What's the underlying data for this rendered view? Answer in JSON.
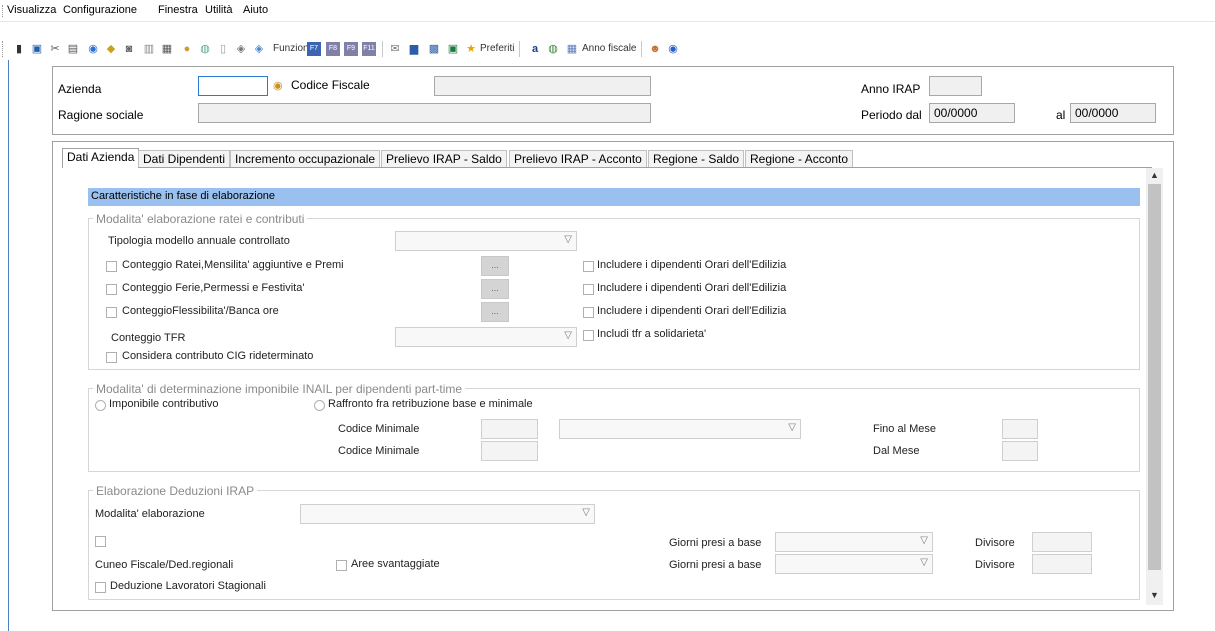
{
  "menu": [
    "Visualizza",
    "Configurazione",
    "Finestra",
    "Utilità",
    "Aiuto"
  ],
  "toolbar": {
    "funzioni_label": "Funzioni:",
    "preferiti_label": "Preferiti",
    "anno_fiscale_label": "Anno fiscale",
    "icons": [
      "pin-icon",
      "save-icon",
      "cut-icon",
      "print-icon",
      "help-icon",
      "info-icon",
      "db-icon",
      "document-icon",
      "calc-icon",
      "color-icon",
      "globe-icon",
      "page-icon",
      "tag-icon",
      "tag2-icon",
      "f7-icon",
      "f8-icon",
      "f9-icon",
      "f11-icon",
      "mail-icon",
      "calendar-icon",
      "chart-icon",
      "excel-icon",
      "star-icon",
      "font-icon",
      "globe2-icon",
      "calendar2-icon",
      "user-icon",
      "help2-icon"
    ]
  },
  "header": {
    "azienda_label": "Azienda",
    "azienda_value": "",
    "codice_fiscale_label": "Codice Fiscale",
    "codice_fiscale_value": "",
    "anno_irap_label": "Anno IRAP",
    "anno_irap_value": "",
    "ragione_sociale_label": "Ragione sociale",
    "ragione_sociale_value": "",
    "periodo_dal_label": "Periodo dal",
    "periodo_dal_value": "00/0000",
    "al_label": "al",
    "al_value": "00/0000"
  },
  "tabs": [
    "Dati Azienda",
    "Dati Dipendenti",
    "Incremento occupazionale",
    "Prelievo IRAP - Saldo",
    "Prelievo IRAP - Acconto",
    "Regione - Saldo",
    "Regione - Acconto"
  ],
  "section_title": "Caratteristiche in fase di elaborazione",
  "group1": {
    "title": "Modalita' elaborazione ratei e contributi",
    "tipologia_label": "Tipologia modello annuale controllato",
    "conteggio_ratei": "Conteggio Ratei,Mensilita' aggiuntive e Premi",
    "conteggio_ferie": "Conteggio Ferie,Permessi e Festivita'",
    "conteggio_flex": "ConteggioFlessibilita'/Banca ore",
    "conteggio_tfr_label": "Conteggio TFR",
    "considera_cig": "Considera contributo CIG rideterminato",
    "includere_1": "Includere i dipendenti Orari dell'Edilizia",
    "includere_2": "Includere i dipendenti Orari dell'Edilizia",
    "includere_3": "Includere i dipendenti Orari dell'Edilizia",
    "includi_tfr": "Includi tfr a solidarieta'",
    "dots": "..."
  },
  "group2": {
    "title": "Modalita' di determinazione imponibile INAIL per dipendenti part-time",
    "imponibile_label": "Imponibile contributivo",
    "raffronto_label": "Raffronto fra retribuzione base e minimale",
    "codice_minimale_1": "Codice Minimale",
    "codice_minimale_2": "Codice Minimale",
    "fino_al_mese": "Fino al Mese",
    "dal_mese": "Dal Mese"
  },
  "group3": {
    "title": "Elaborazione Deduzioni IRAP",
    "modalita_label": "Modalita' elaborazione",
    "cuneo_label": "Cuneo Fiscale/Ded.regionali",
    "aree_label": "Aree svantaggiate",
    "deduzione_label": "Deduzione Lavoratori  Stagionali",
    "giorni_1": "Giorni presi a base",
    "giorni_2": "Giorni presi a base",
    "divisore_1": "Divisore",
    "divisore_2": "Divisore"
  }
}
